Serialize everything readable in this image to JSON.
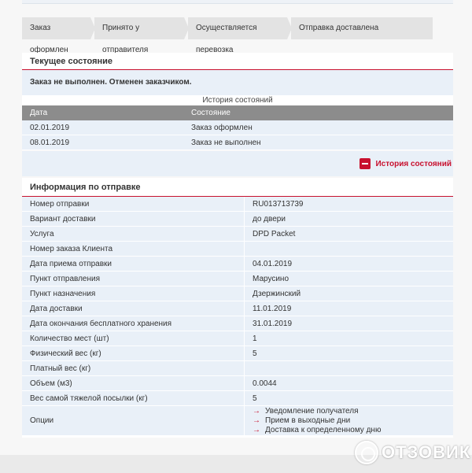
{
  "steps": [
    "Заказ оформлен",
    "Принято у отправителя",
    "Осуществляется перевозка",
    "Отправка доставлена"
  ],
  "current_state": {
    "title": "Текущее состояние",
    "status_text": "Заказ не выполнен.  Отменен заказчиком."
  },
  "history": {
    "caption": "История состояний",
    "headers": [
      "Дата",
      "Состояние"
    ],
    "rows": [
      {
        "date": "02.01.2019",
        "state": "Заказ оформлен"
      },
      {
        "date": "08.01.2019",
        "state": "Заказ не выполнен"
      }
    ],
    "toggle_label": "История состояний"
  },
  "shipment_info": {
    "title": "Информация по отправке",
    "rows": [
      {
        "label": "Номер отправки",
        "value": "RU013713739"
      },
      {
        "label": "Вариант доставки",
        "value": "до двери"
      },
      {
        "label": "Услуга",
        "value": "DPD Packet"
      },
      {
        "label": "Номер заказа Клиента",
        "value": ""
      },
      {
        "label": "Дата приема отправки",
        "value": "04.01.2019"
      },
      {
        "label": "Пункт отправления",
        "value": "Марусино"
      },
      {
        "label": "Пункт назначения",
        "value": "Дзержинский"
      },
      {
        "label": "Дата доставки",
        "value": "11.01.2019"
      },
      {
        "label": "Дата окончания бесплатного хранения",
        "value": "31.01.2019"
      },
      {
        "label": "Количество мест (шт)",
        "value": "1"
      },
      {
        "label": "Физический вес (кг)",
        "value": "5"
      },
      {
        "label": "Платный вес (кг)",
        "value": ""
      },
      {
        "label": "Объем (м3)",
        "value": "0.0044"
      },
      {
        "label": "Вес самой тяжелой посылки (кг)",
        "value": "5"
      }
    ],
    "options_label": "Опции",
    "options": [
      "Уведомление получателя",
      "Прием в выходные дни",
      "Доставка к определенному дню"
    ]
  },
  "watermark": "ОТЗОВИК",
  "colors": {
    "accent": "#c8102e",
    "row_bg": "#e9f0f8",
    "header_bg": "#8c8c8c"
  }
}
